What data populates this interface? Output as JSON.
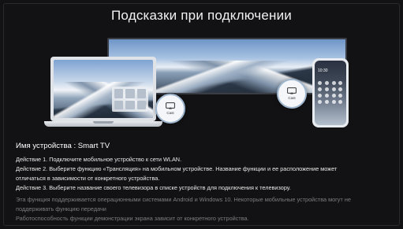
{
  "header": {
    "title": "Подсказки при подключении"
  },
  "illustration": {
    "cast_label": "Cast",
    "phone_time": "10:30"
  },
  "device": {
    "name_label": "Имя устройства : Smart TV"
  },
  "steps": [
    "Действие 1. Подключите мобильное устройство к сети WLAN.",
    "Действие 2. Выберите функцию «Трансляция»  на мобильном устройстве. Название функции и ее расположение может",
    "отличаться в зависимости от конкретного устройства.",
    "Действие 3. Выберите название своего телевизора в списке устройств для подключения к телевизору."
  ],
  "notes": [
    "Эта функция поддерживается операционными системами Android и Windows 10. Некоторые мобильные устройства могут не",
    "поддерживать функцию передачи",
    "Работоспособность функции демонстрации экрана зависит от конкретного устройства."
  ],
  "colors": {
    "background": "#121214",
    "text_primary": "#e9e9e9",
    "text_dim": "#7d7d82"
  }
}
